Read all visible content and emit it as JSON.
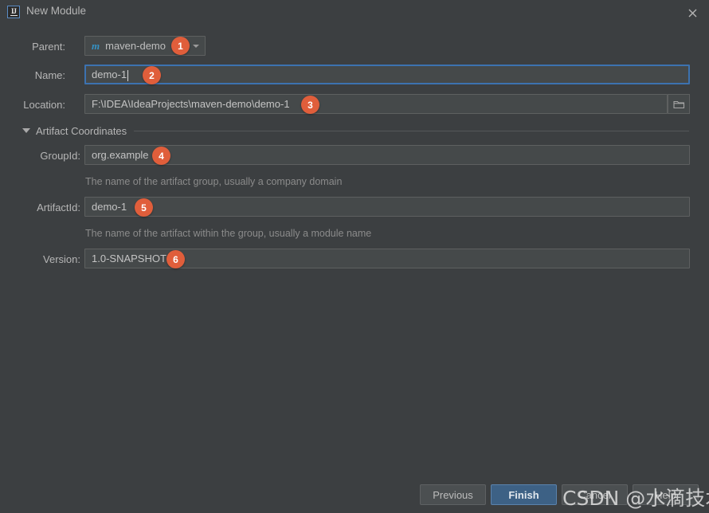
{
  "window": {
    "title": "New Module",
    "app_icon": "intellij-idea-icon",
    "close_icon": "close-icon",
    "background_color": "#3c3f41",
    "accent_color": "#3d6185",
    "badge_color": "#e05e3b"
  },
  "form": {
    "parent": {
      "label": "Parent:",
      "value": "maven-demo",
      "icon": "maven-icon",
      "dropdown_icon": "chevron-down-icon"
    },
    "name": {
      "label": "Name:",
      "value": "demo-1",
      "focused": true
    },
    "location": {
      "label": "Location:",
      "value": "F:\\IDEA\\IdeaProjects\\maven-demo\\demo-1",
      "browse_icon": "folder-icon"
    }
  },
  "artifact_coordinates": {
    "section_label": "Artifact Coordinates",
    "expanded": true,
    "collapse_icon": "triangle-down-icon",
    "group_id": {
      "label": "GroupId:",
      "value": "org.example",
      "hint": "The name of the artifact group, usually a company domain"
    },
    "artifact_id": {
      "label": "ArtifactId:",
      "value": "demo-1",
      "hint": "The name of the artifact within the group, usually a module name"
    },
    "version": {
      "label": "Version:",
      "value": "1.0-SNAPSHOT"
    }
  },
  "buttons": {
    "previous": "Previous",
    "finish": "Finish",
    "cancel": "Cancel",
    "help": "Help"
  },
  "annotations": [
    {
      "number": "1",
      "target": "parent-combo"
    },
    {
      "number": "2",
      "target": "name-input"
    },
    {
      "number": "3",
      "target": "location-input"
    },
    {
      "number": "4",
      "target": "groupid-input"
    },
    {
      "number": "5",
      "target": "artifactid-input"
    },
    {
      "number": "6",
      "target": "version-input"
    }
  ],
  "watermark": {
    "text": "CSDN @水滴技术"
  }
}
